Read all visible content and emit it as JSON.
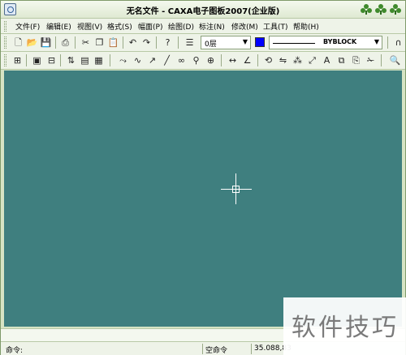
{
  "window": {
    "title": "无名文件 - CAXA电子图板2007(企业版)"
  },
  "menu": [
    {
      "label": "文件(F)",
      "key": "file"
    },
    {
      "label": "编辑(E)",
      "key": "edit"
    },
    {
      "label": "视图(V)",
      "key": "view"
    },
    {
      "label": "格式(S)",
      "key": "format"
    },
    {
      "label": "幅面(P)",
      "key": "sheet"
    },
    {
      "label": "绘图(D)",
      "key": "draw"
    },
    {
      "label": "标注(N)",
      "key": "dimension"
    },
    {
      "label": "修改(M)",
      "key": "modify"
    },
    {
      "label": "工具(T)",
      "key": "tools"
    },
    {
      "label": "帮助(H)",
      "key": "help"
    }
  ],
  "toolbar": {
    "layer_value": "0层",
    "current_color": "#0000ff",
    "linetype_value": "BYBLOCK",
    "row1_icons": [
      "new-icon",
      "open-icon",
      "save-icon",
      "print-icon",
      "cut-icon",
      "copy-icon",
      "paste-icon",
      "undo-icon",
      "redo-icon",
      "help-icon",
      "layer-icon"
    ],
    "row2_icons": [
      "snap-icon",
      "zoom-window-icon",
      "zoom-all-icon",
      "dynamic-pan-icon",
      "view-icon",
      "render-icon",
      "polyline-icon",
      "spline-icon",
      "arc-icon",
      "line-icon",
      "circle-icon",
      "hatch-icon",
      "center-icon",
      "dimension-icon",
      "angle-icon",
      "rotate-icon",
      "mirror-icon",
      "array-icon",
      "scale-icon",
      "text-icon",
      "block-icon",
      "insert-icon",
      "trim-icon",
      "extend-icon",
      "search-icon"
    ]
  },
  "canvas": {
    "background": "#3f7f7f"
  },
  "status": {
    "prompt_label": "命令:",
    "mode_text": "空命令",
    "coordinates": "35.088,83"
  },
  "watermark": {
    "text": "软件技巧"
  }
}
